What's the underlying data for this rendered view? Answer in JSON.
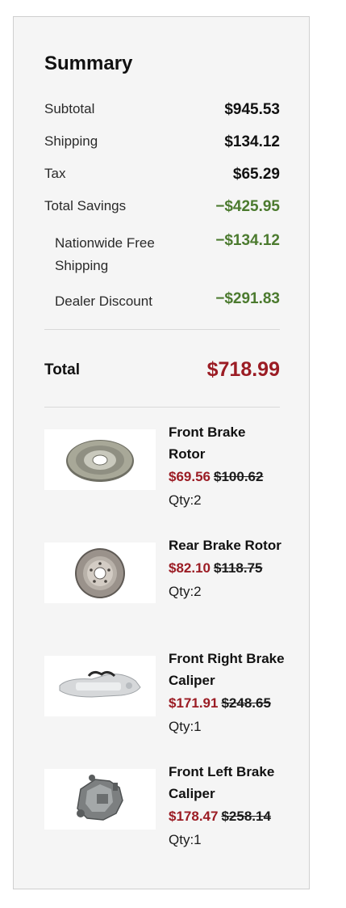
{
  "summary": {
    "title": "Summary",
    "subtotal_label": "Subtotal",
    "subtotal_value": "$945.53",
    "shipping_label": "Shipping",
    "shipping_value": "$134.12",
    "tax_label": "Tax",
    "tax_value": "$65.29",
    "savings_label": "Total Savings",
    "savings_value": "−$425.95",
    "nationwide_label": "Nationwide Free Shipping",
    "nationwide_value": "−$134.12",
    "dealer_label": "Dealer Discount",
    "dealer_value": "−$291.83",
    "total_label": "Total",
    "total_value": "$718.99"
  },
  "items": [
    {
      "name": "Front Brake Rotor",
      "sale_price": "$69.56",
      "original_price": "$100.62",
      "qty": "Qty:2",
      "icon": "brake-rotor-icon"
    },
    {
      "name": "Rear Brake Rotor",
      "sale_price": "$82.10",
      "original_price": "$118.75",
      "qty": "Qty:2",
      "icon": "brake-rotor-icon"
    },
    {
      "name": "Front Right Brake Caliper",
      "sale_price": "$171.91",
      "original_price": "$248.65",
      "qty": "Qty:1",
      "icon": "brake-caliper-icon"
    },
    {
      "name": "Front Left Brake Caliper",
      "sale_price": "$178.47",
      "original_price": "$258.14",
      "qty": "Qty:1",
      "icon": "brake-caliper-icon"
    }
  ],
  "colors": {
    "sale_red": "#9b1c24",
    "savings_green": "#4b7a2e",
    "panel_bg": "#f5f5f5"
  }
}
